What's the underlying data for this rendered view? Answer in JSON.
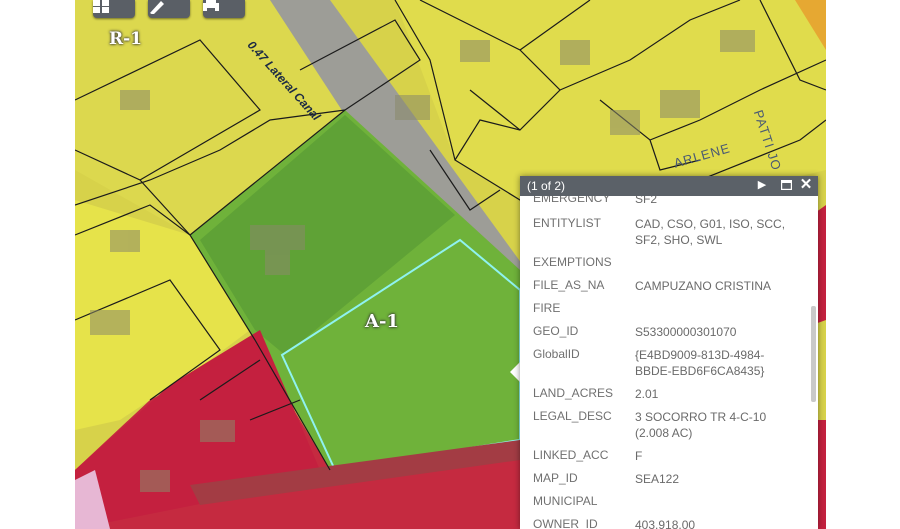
{
  "map": {
    "zones": [
      {
        "id": "r1",
        "label": "R-1"
      },
      {
        "id": "a1",
        "label": "A-1"
      }
    ],
    "canal_label": "0.47 Lateral Canal",
    "streets": [
      {
        "name": "ARLENE"
      },
      {
        "name": "PATTI JO"
      }
    ],
    "colors": {
      "residential": "#e4e23a",
      "agricultural": "#5fb03a",
      "commercial": "#c4213f",
      "road": "#9a9a9a",
      "selection": "#8ff2f0"
    }
  },
  "toolbar": {
    "buttons": [
      {
        "name": "basemap-gallery",
        "icon": "grid-icon"
      },
      {
        "name": "measure",
        "icon": "ruler-icon"
      },
      {
        "name": "print",
        "icon": "printer-icon"
      }
    ]
  },
  "popup": {
    "count": "(1 of 2)",
    "attributes": [
      {
        "key": "EMERGENCY",
        "value": "SF2"
      },
      {
        "key": "ENTITYLIST",
        "value": "CAD, CSO, G01, ISO, SCC, SF2, SHO, SWL"
      },
      {
        "key": "EXEMPTIONS",
        "value": ""
      },
      {
        "key": "FILE_AS_NA",
        "value": "CAMPUZANO CRISTINA"
      },
      {
        "key": "FIRE",
        "value": ""
      },
      {
        "key": "GEO_ID",
        "value": "S53300000301070"
      },
      {
        "key": "GlobalID",
        "value": "{E4BD9009-813D-4984-BBDE-EBD6F6CA8435}"
      },
      {
        "key": "LAND_ACRES",
        "value": "2.01"
      },
      {
        "key": "LEGAL_DESC",
        "value": "3 SOCORRO TR 4-C-10 (2.008 AC)"
      },
      {
        "key": "LINKED_ACC",
        "value": "F"
      },
      {
        "key": "MAP_ID",
        "value": "SEA122"
      },
      {
        "key": "MUNICIPAL",
        "value": ""
      },
      {
        "key": "OWNER_ID",
        "value": "403.918.00"
      }
    ]
  }
}
